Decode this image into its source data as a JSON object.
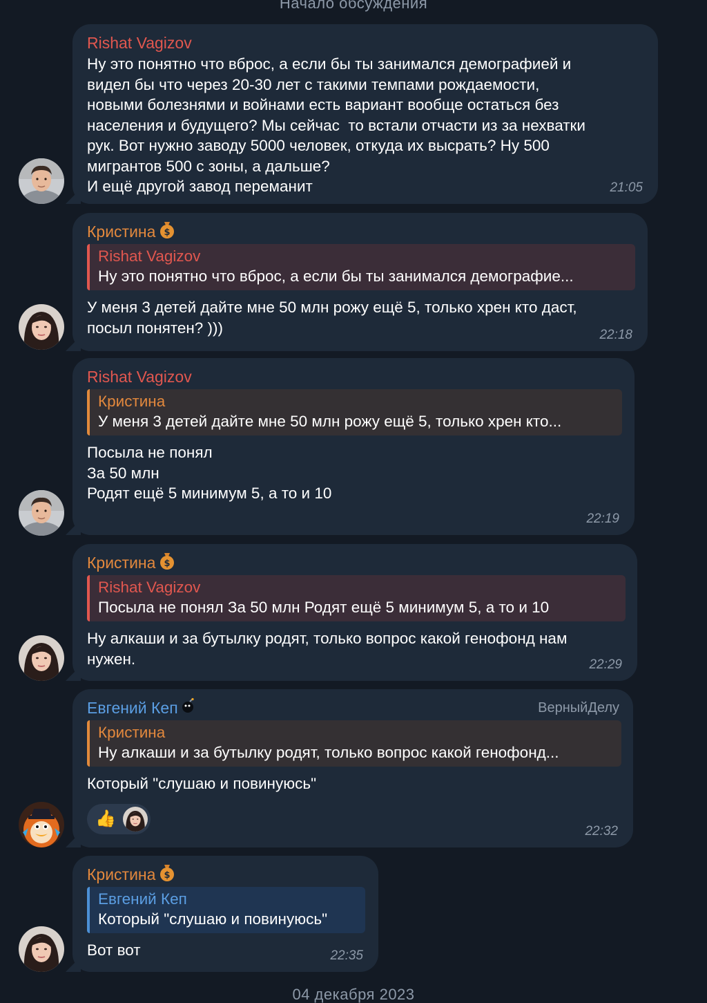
{
  "top_separator": "Начало обсуждения",
  "bottom_separator": "04 декабря 2023",
  "colors": {
    "background": "#131a24",
    "bubble": "#1e2a39",
    "name_red": "#e1574f",
    "name_orange": "#e2883d",
    "name_blue": "#5b9ee3"
  },
  "messages": [
    {
      "sender": "Rishat Vagizov",
      "text": "Ну это понятно что вброс, а если бы ты занимался демографией и\nвидел бы что через 20-30 лет с такими темпами рождаемости,\nновыми болезнями и войнами есть вариант вообще остаться без\nнаселения и будущего? Мы сейчас  то встали отчасти из за нехватки\nрук. Вот нужно заводу 5000 человек, откуда их высрать? Ну 500\nмигрантов 500 с зоны, а дальше?\nИ ещё другой завод переманит",
      "time": "21:05",
      "avatar_icon": "man-avatar"
    },
    {
      "sender": "Кристина",
      "badge_icon": "money-bag-icon",
      "reply": {
        "name": "Rishat Vagizov",
        "text": "Ну это понятно что вброс, а если бы ты занимался демографие..."
      },
      "text": "У меня 3 детей дайте мне 50 млн рожу ещё 5, только хрен кто даст,\nпосыл понятен? )))",
      "time": "22:18",
      "avatar_icon": "woman-avatar"
    },
    {
      "sender": "Rishat Vagizov",
      "reply": {
        "name": "Кристина",
        "text": "У меня 3 детей дайте мне 50 млн рожу ещё 5, только хрен кто..."
      },
      "text": "Посыла не понял\nЗа 50 млн\nРодят ещё 5 минимум 5, а то и 10",
      "time": "22:19",
      "avatar_icon": "man-avatar"
    },
    {
      "sender": "Кристина",
      "badge_icon": "money-bag-icon",
      "reply": {
        "name": "Rishat Vagizov",
        "text": "Посыла не понял  За 50 млн Родят ещё 5 минимум 5, а то и 10"
      },
      "text": "Ну алкаши и за бутылку родят, только вопрос какой генофонд нам\nнужен.",
      "time": "22:29",
      "avatar_icon": "woman-avatar"
    },
    {
      "sender": "Евгений Кеп",
      "badge_icon": "bomb-icon",
      "role": "ВерныйДелу",
      "reply": {
        "name": "Кристина",
        "text": "Ну алкаши и за бутылку родят, только вопрос какой генофонд..."
      },
      "text": "Который \"слушаю и повинуюсь\"",
      "reaction": {
        "emoji": "👍",
        "icon": "thumbs-up-icon"
      },
      "time": "22:32",
      "avatar_icon": "cartoon-duck-avatar"
    },
    {
      "sender": "Кристина",
      "badge_icon": "money-bag-icon",
      "reply": {
        "name": "Евгений Кеп",
        "text": "Который \"слушаю и повинуюсь\""
      },
      "text": "Вот вот",
      "time": "22:35",
      "avatar_icon": "woman-avatar"
    }
  ]
}
